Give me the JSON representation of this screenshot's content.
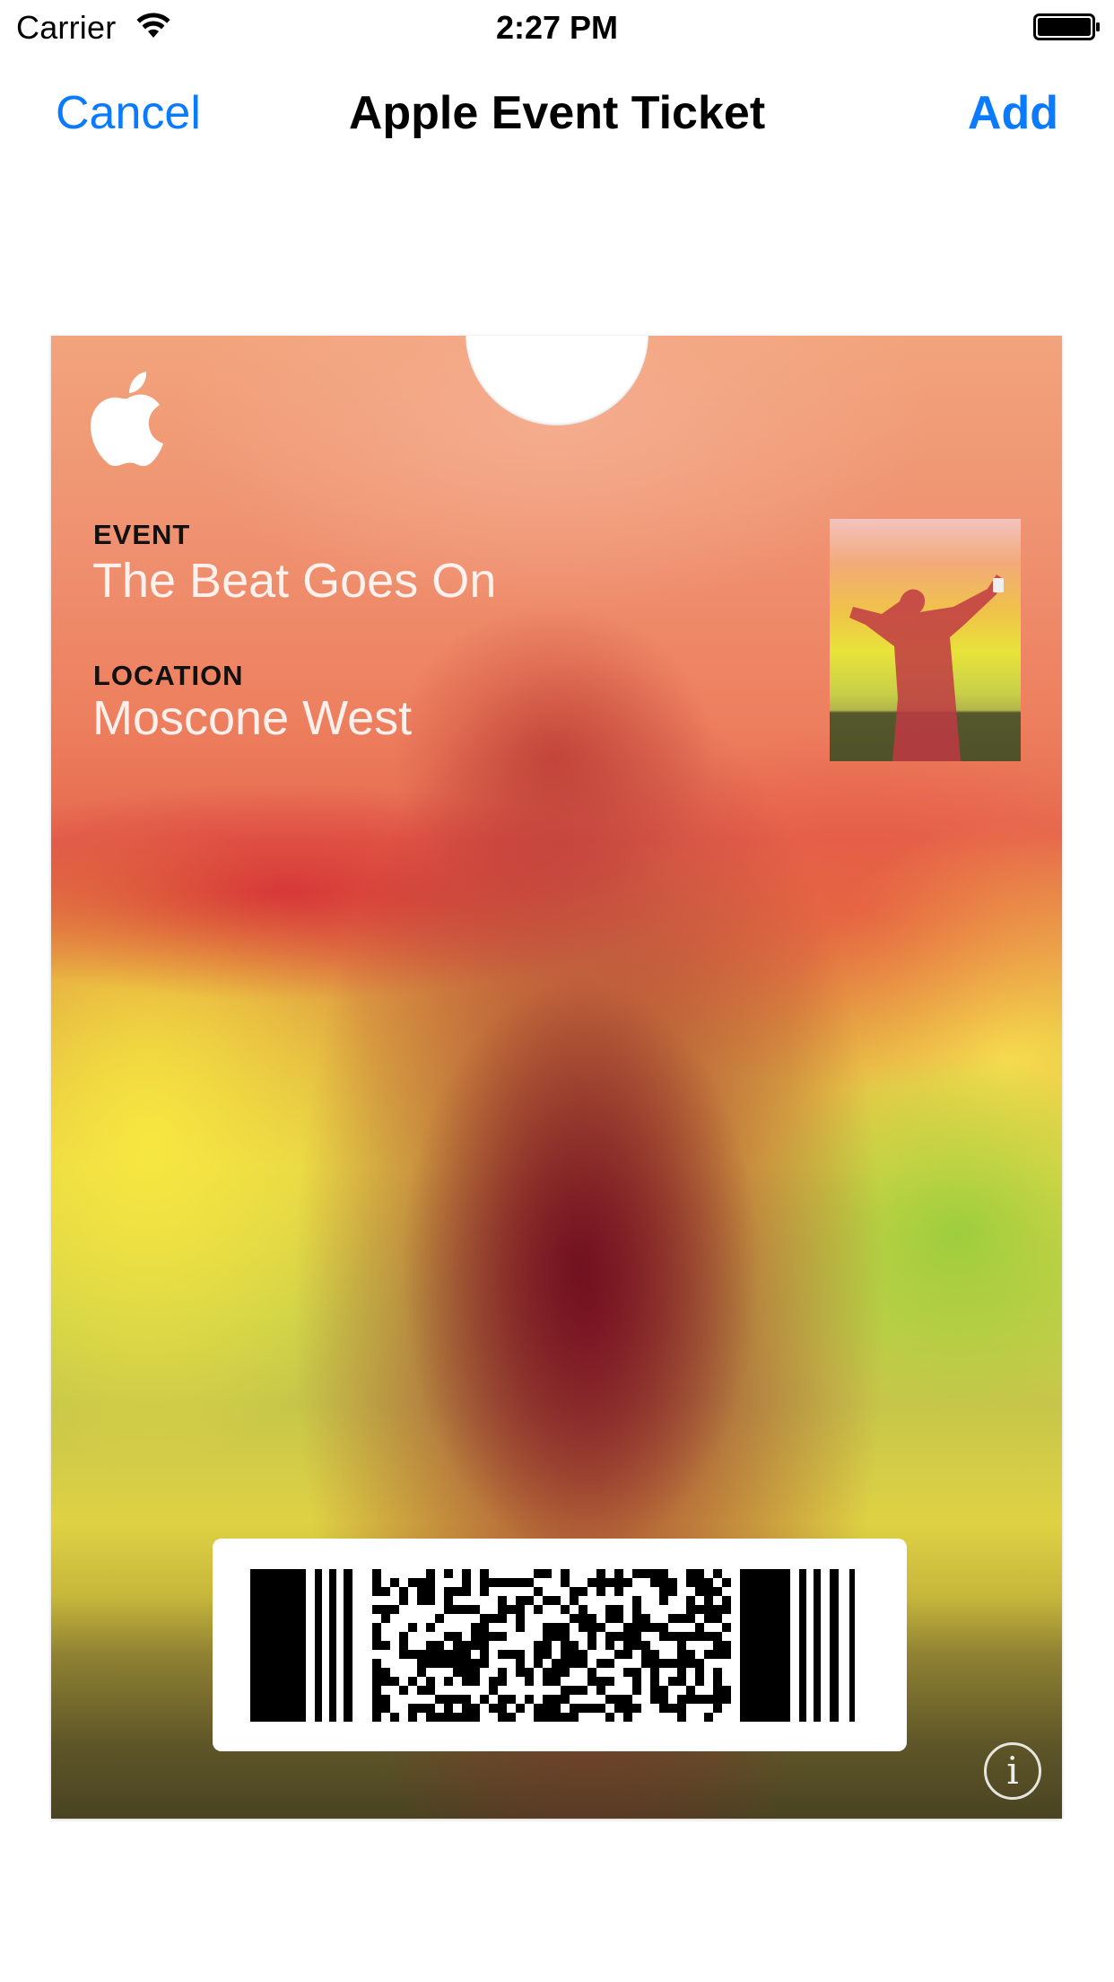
{
  "status_bar": {
    "carrier": "Carrier",
    "time": "2:27 PM",
    "wifi_icon": "wifi-icon",
    "battery_icon": "battery-full-icon"
  },
  "nav": {
    "cancel_label": "Cancel",
    "title": "Apple Event Ticket",
    "add_label": "Add",
    "accent_color": "#0a7aff"
  },
  "pass": {
    "logo_icon": "apple-logo-icon",
    "fields": [
      {
        "label": "EVENT",
        "value": "The Beat Goes On"
      },
      {
        "label": "LOCATION",
        "value": "Moscone West"
      }
    ],
    "thumbnail": "event-artwork-thumbnail",
    "barcode": "pdf417-barcode",
    "info_icon": "info-icon",
    "info_glyph": "i"
  }
}
